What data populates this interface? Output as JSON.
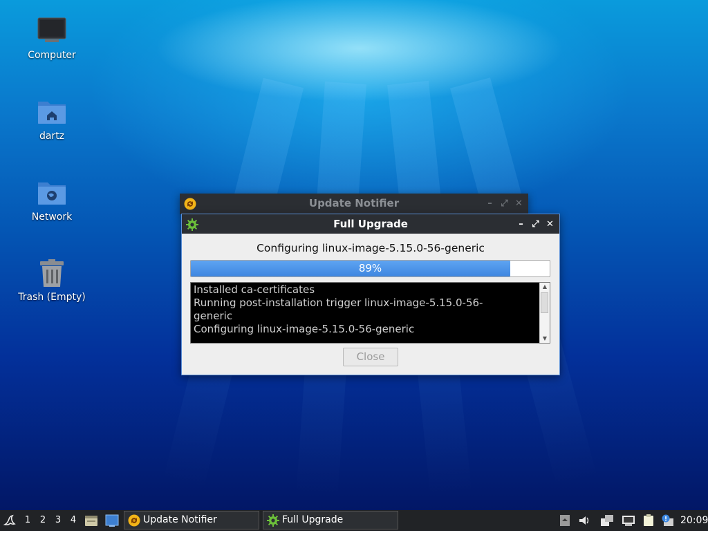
{
  "desktop": {
    "icons": [
      {
        "label": "Computer",
        "icon": "computer-icon"
      },
      {
        "label": "dartz",
        "icon": "home-folder-icon"
      },
      {
        "label": "Network",
        "icon": "network-folder-icon"
      },
      {
        "label": "Trash (Empty)",
        "icon": "trash-icon"
      }
    ]
  },
  "windows": {
    "notifier": {
      "title": "Update Notifier",
      "icon": "update-notifier-icon"
    },
    "upgrade": {
      "title": "Full Upgrade",
      "icon": "gear-icon",
      "status": "Configuring linux-image-5.15.0-56-generic",
      "progress": {
        "value": 0.89,
        "label": "89%"
      },
      "log": [
        "Installed ca-certificates",
        "Running post-installation trigger linux-image-5.15.0-56-",
        "generic",
        "Configuring linux-image-5.15.0-56-generic"
      ],
      "close_label": "Close"
    },
    "controls": {
      "minimize": "–",
      "maximize": "⤢",
      "close": "✕"
    }
  },
  "taskbar": {
    "workspaces": [
      "1",
      "2",
      "3",
      "4"
    ],
    "tasks": [
      {
        "label": "Update Notifier",
        "icon": "update-notifier-icon"
      },
      {
        "label": "Full Upgrade",
        "icon": "gear-icon"
      }
    ],
    "clock": "20:09"
  },
  "colors": {
    "accent": "#3e86e0",
    "titlebar": "#2b2e33",
    "taskbar": "#212326"
  }
}
